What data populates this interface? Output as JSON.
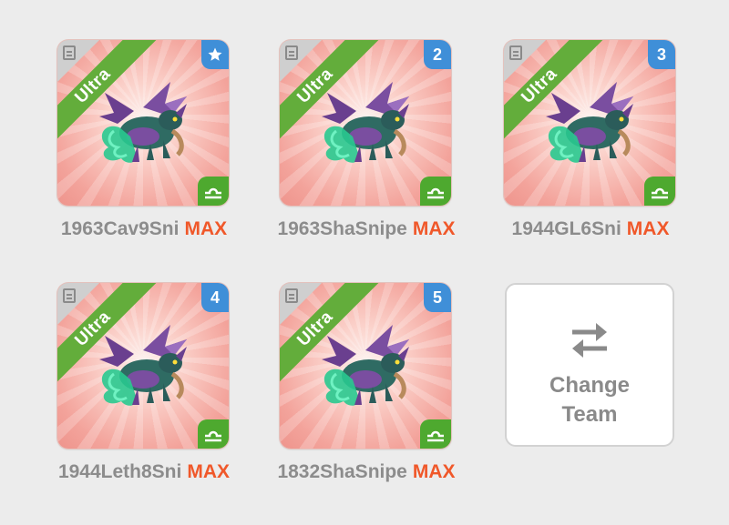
{
  "tier_label": "Ultra",
  "max_label": "MAX",
  "team": [
    {
      "slot": "★",
      "name": "1963Cav9Sni",
      "icon": "star-icon"
    },
    {
      "slot": "2",
      "name": "1963ShaSnipe"
    },
    {
      "slot": "3",
      "name": "1944GL6Sni"
    },
    {
      "slot": "4",
      "name": "1944Leth8Sni"
    },
    {
      "slot": "5",
      "name": "1832ShaSnipe"
    }
  ],
  "change_team": {
    "line1": "Change",
    "line2": "Team",
    "icon": "swap-arrows-icon"
  },
  "colors": {
    "ribbon": "#63ad3b",
    "badge": "#3f8fd8",
    "max": "#f0582a",
    "libra": "#4ea92f"
  }
}
